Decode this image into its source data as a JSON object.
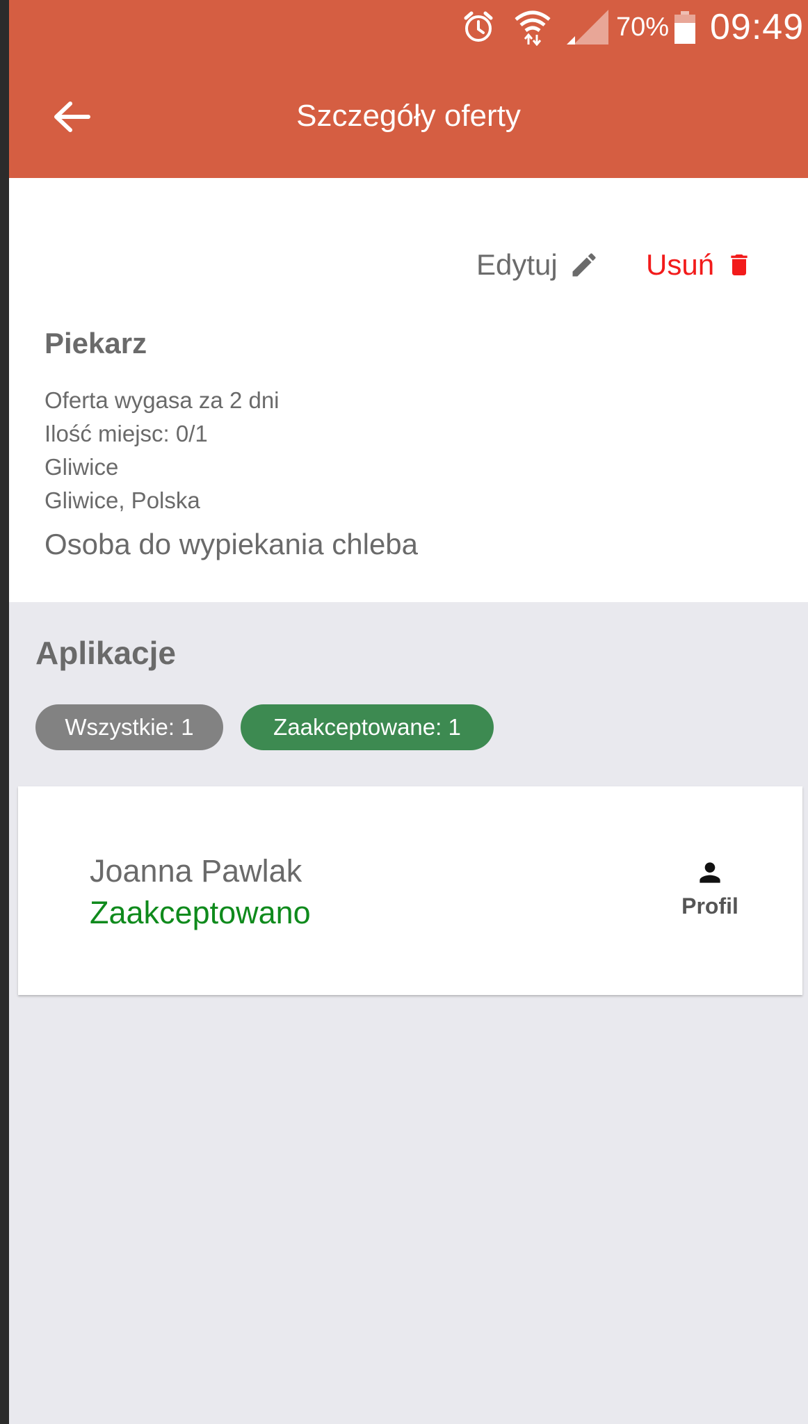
{
  "status_bar": {
    "battery_percent": "70%",
    "time": "09:49",
    "icons": [
      "alarm-icon",
      "wifi-icon",
      "cell-signal-icon",
      "battery-icon"
    ]
  },
  "app_bar": {
    "title": "Szczegóły oferty",
    "back_icon": "arrow-left-icon"
  },
  "offer": {
    "edit_label": "Edytuj",
    "delete_label": "Usuń",
    "title": "Piekarz",
    "expires": "Oferta wygasa za 2 dni",
    "slots": "Ilość miejsc: 0/1",
    "city": "Gliwice",
    "location": "Gliwice, Polska",
    "description": "Osoba do wypiekania chleba"
  },
  "applications": {
    "title": "Aplikacje",
    "filters": {
      "all": "Wszystkie: 1",
      "accepted": "Zaakceptowane: 1"
    },
    "items": [
      {
        "name": "Joanna Pawlak",
        "status": "Zaakceptowano",
        "profile_label": "Profil"
      }
    ]
  },
  "colors": {
    "primary": "#d55e42",
    "delete": "#f21b1b",
    "accepted_chip": "#3d8a51",
    "all_chip": "#828282",
    "accepted_text": "#0f8a1c",
    "background": "#e9e9ee"
  }
}
